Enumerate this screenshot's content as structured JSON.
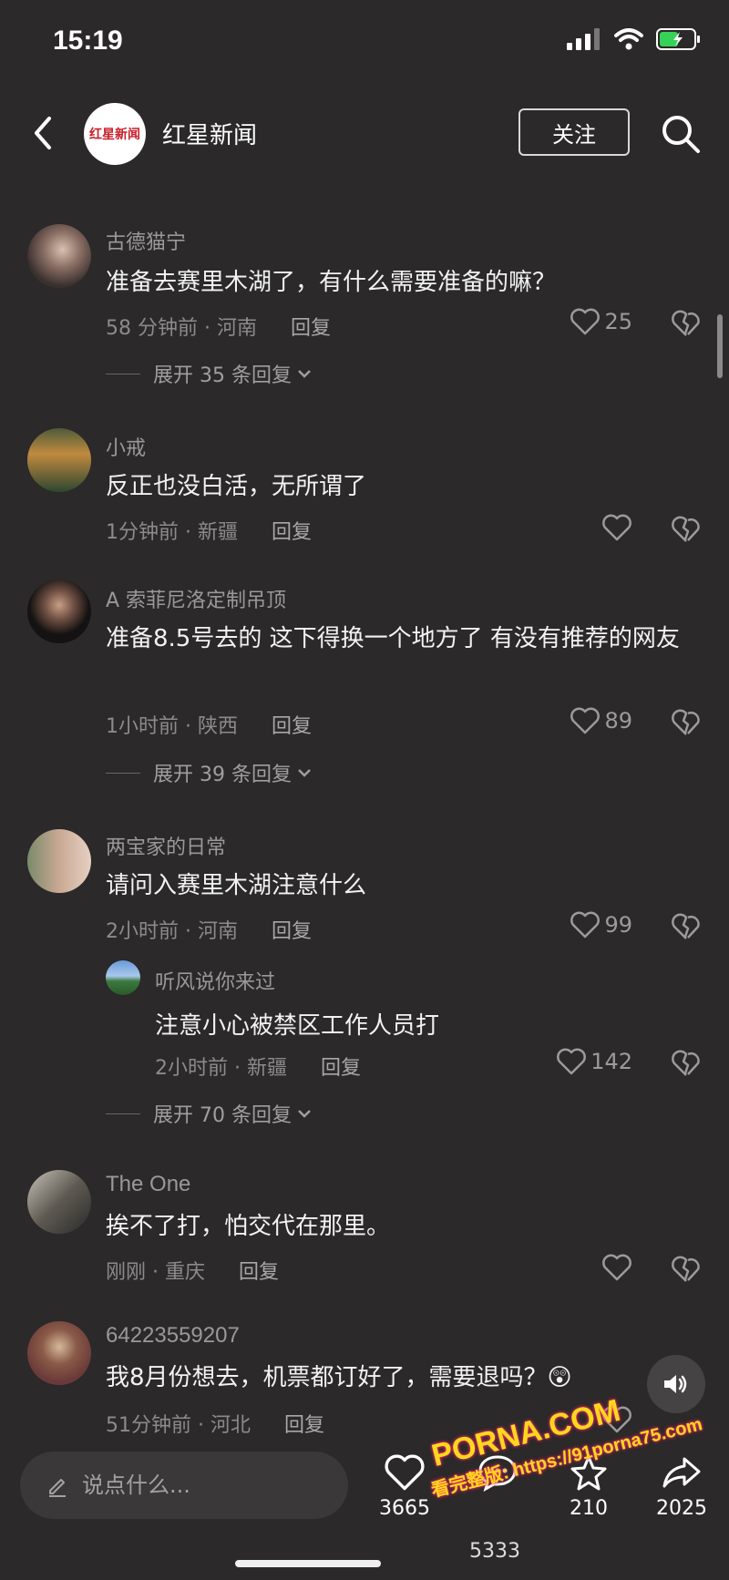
{
  "status": {
    "time": "15:19"
  },
  "header": {
    "channel_name": "红星新闻",
    "logo_text": "红星新闻",
    "follow_label": "关注"
  },
  "comments": [
    {
      "user": "古德猫宁",
      "text": "准备去赛里木湖了，有什么需要准备的嘛？",
      "time_loc": "58 分钟前 · 河南",
      "reply": "回复",
      "likes": "25",
      "expand": "展开 35 条回复"
    },
    {
      "user": "小戒",
      "text": "反正也没白活，无所谓了",
      "time_loc": "1分钟前 · 新疆",
      "reply": "回复",
      "likes": ""
    },
    {
      "user": "A 索菲尼洛定制吊顶",
      "text": "准备8.5号去的 这下得换一个地方了 有没有推荐的网友",
      "time_loc": "1小时前 · 陕西",
      "reply": "回复",
      "likes": "89",
      "expand": "展开 39 条回复"
    },
    {
      "user": "两宝家的日常",
      "text": "请问入赛里木湖注意什么",
      "time_loc": "2小时前 · 河南",
      "reply": "回复",
      "likes": "99",
      "sub_reply": {
        "user": "听风说你来过",
        "text": "注意小心被禁区工作人员打",
        "time_loc": "2小时前 · 新疆",
        "reply": "回复",
        "likes": "142"
      },
      "expand": "展开 70 条回复"
    },
    {
      "user": "The One",
      "text": "挨不了打，怕交代在那里。",
      "time_loc": "刚刚 · 重庆",
      "reply": "回复",
      "likes": ""
    },
    {
      "user": "64223559207",
      "text": "我8月份想去，机票都订好了，需要退吗？😲",
      "time_loc": "51分钟前 · 河北",
      "reply": "回复",
      "likes": ""
    }
  ],
  "bottom_bar": {
    "input_placeholder": "说点什么...",
    "like_count": "3665",
    "comment_count": "5333",
    "star_count": "210",
    "share_count": "2025"
  },
  "watermark": {
    "line1": "PORNA.COM",
    "line2": "看完整版: https://91porna75.com"
  },
  "icons": [
    "back-arrow-icon",
    "search-icon",
    "heart-icon",
    "broken-heart-icon",
    "chevron-down-icon",
    "volume-icon",
    "pen-icon",
    "comment-icon",
    "star-icon",
    "share-icon"
  ]
}
